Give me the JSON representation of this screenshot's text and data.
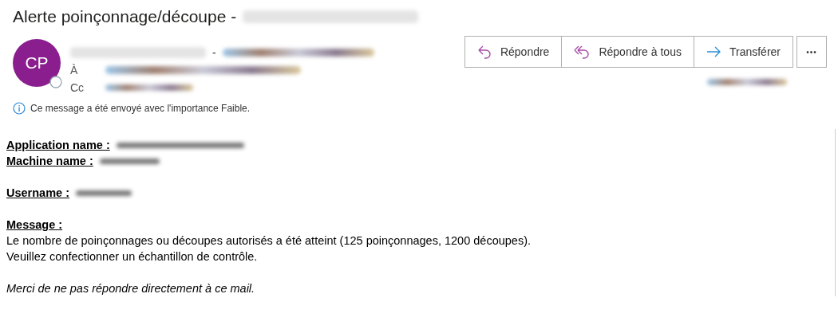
{
  "subject": {
    "text": "Alerte poinçonnage/découpe -"
  },
  "sender": {
    "initials": "CP",
    "separator": "-",
    "to_label": "À",
    "cc_label": "Cc"
  },
  "actions": [
    {
      "kind": "reply",
      "label": "Répondre"
    },
    {
      "kind": "reply_all",
      "label": "Répondre à tous"
    },
    {
      "kind": "forward",
      "label": "Transférer"
    },
    {
      "kind": "more",
      "label": "•••"
    }
  ],
  "importance_notice": "Ce message a été envoyé avec l'importance Faible.",
  "body": {
    "fields": [
      {
        "label": "Application name :"
      },
      {
        "label": "Machine name :"
      },
      {
        "label": "Username :"
      }
    ],
    "message_label": "Message :",
    "message_lines": [
      "Le nombre de poinçonnages ou découpes autorisés a été atteint (125 poinçonnages, 1200 découpes).",
      "Veuillez confectionner un échantillon de contrôle."
    ],
    "footer": "Merci de ne pas répondre directement à ce mail."
  }
}
